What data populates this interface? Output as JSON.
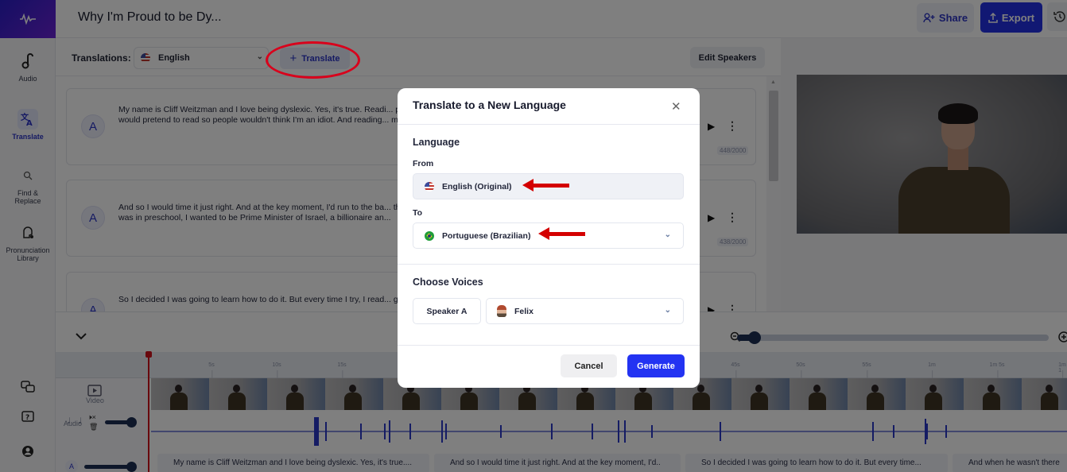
{
  "app": {
    "doc_title": "Why I'm Proud to be Dy...",
    "brand_color": "#2a1ec9",
    "accent_color": "#2333f2"
  },
  "header": {
    "share_label": "Share",
    "export_label": "Export"
  },
  "rail": {
    "items": [
      {
        "label": "Audio",
        "icon": "audio-icon",
        "active": false
      },
      {
        "label": "Translate",
        "icon": "translate-icon",
        "active": true
      },
      {
        "label": "Find & Replace",
        "icon": "search-icon",
        "active": false
      },
      {
        "label": "Pronunciation Library",
        "icon": "pronunciation-icon",
        "active": false
      }
    ],
    "bottom_icons": [
      "chat-icon",
      "help-icon",
      "account-icon"
    ]
  },
  "translations_bar": {
    "label": "Translations:",
    "selected_language": "English",
    "translate_button": "Translate",
    "edit_speakers_button": "Edit Speakers"
  },
  "segments": [
    {
      "speaker": "A",
      "text": "My name is Cliff Weitzman and I love being dyslexic. Yes, it's true. Readi... people to do a four digit long division multiplication in their head. And in... would pretend to read so people wouldn't think I'm an idiot. And reading... me.",
      "char_count": "448/2000"
    },
    {
      "speaker": "A",
      "text": "And so I would time it just right. And at the key moment, I'd run to the ba... them thinking I'm stupid. But I did really want to learn how to read. I drea... was in preschool, I wanted to be Prime Minister of Israel, a billionaire an...",
      "char_count": "438/2000"
    },
    {
      "speaker": "A",
      "text": "So I decided I was going to learn how to do it. But every time I try, I read... gave up. But my dad didn't give up on me. He never gave up on me, eve...",
      "char_count": ""
    }
  ],
  "timeline": {
    "ticks": [
      "5s",
      "10s",
      "15s",
      "45s",
      "50s",
      "55s",
      "1m",
      "1m 5s",
      "1m 1"
    ],
    "zoom_level": 0.03,
    "tracks": {
      "video_label": "Video",
      "audio_label": "Audio",
      "speaker_chip": "A"
    },
    "audio_volume": 1.0,
    "speaker_volume": 1.0,
    "captions": [
      "My name is Cliff Weitzman and I love being dyslexic. Yes, it's true....",
      "And so I would time it just right. And at the key moment, I'd..",
      "So I decided I was going to learn how to do it. But every time...",
      "And when he wasn't there"
    ]
  },
  "modal": {
    "title": "Translate to a New Language",
    "language_section": "Language",
    "from_label": "From",
    "from_value": "English (Original)",
    "to_label": "To",
    "to_value": "Portuguese (Brazilian)",
    "voices_section": "Choose Voices",
    "speaker_label": "Speaker A",
    "voice_value": "Felix",
    "cancel_button": "Cancel",
    "generate_button": "Generate"
  }
}
